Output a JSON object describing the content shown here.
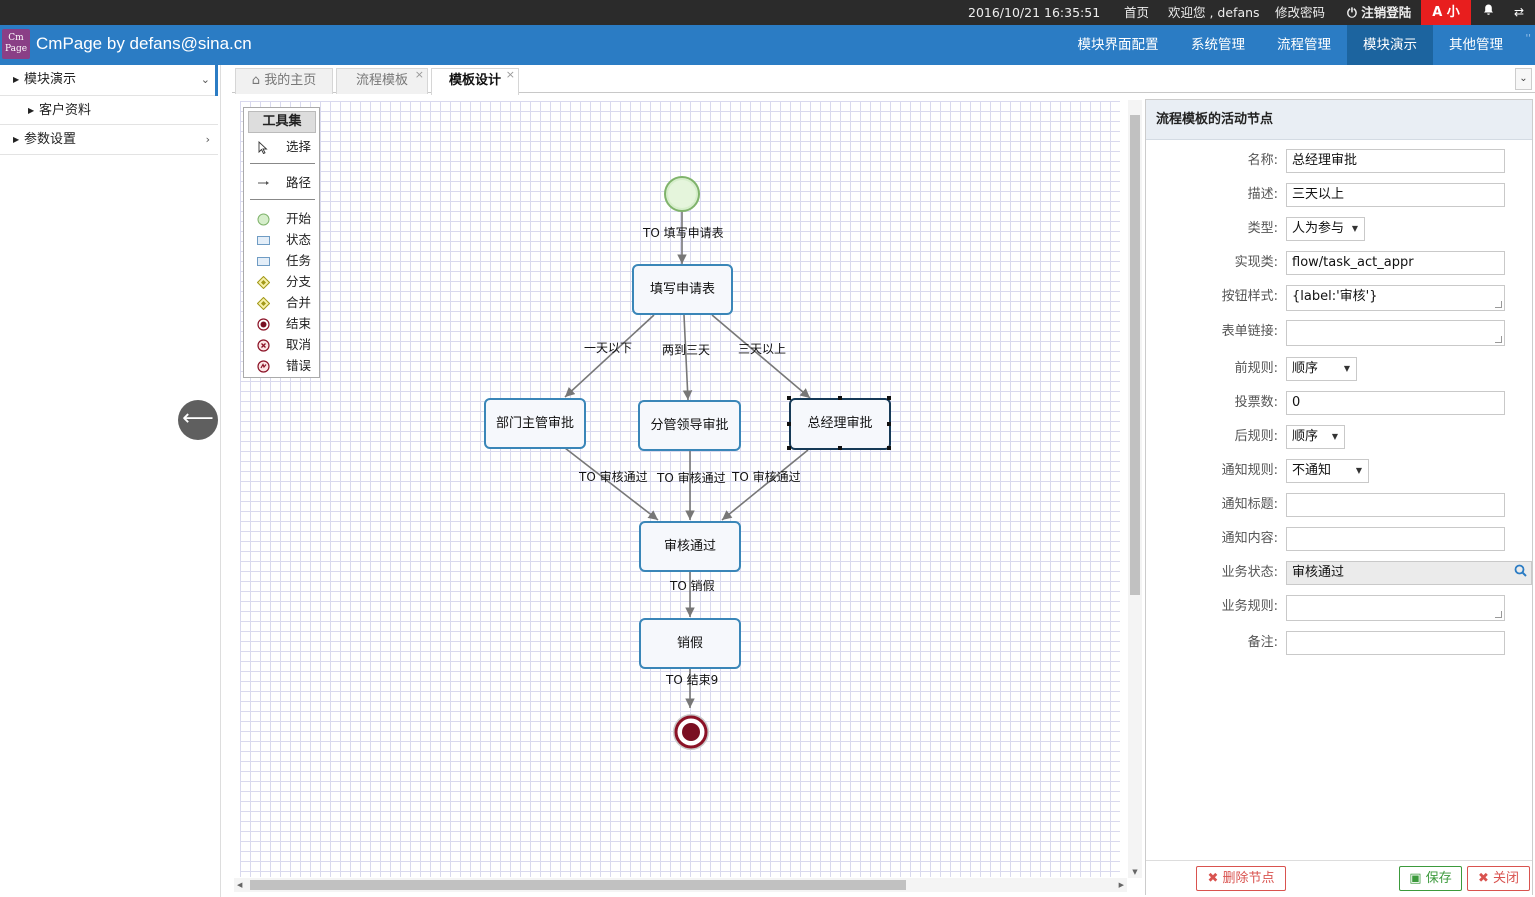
{
  "topbar": {
    "datetime": "2016/10/21 16:35:51",
    "home": "首页",
    "welcome": "欢迎您 , defans",
    "change_password": "修改密码",
    "logout": "注销登陆",
    "font_toggle": "A 小",
    "bell_icon": "bell-icon",
    "swap_icon": "swap-icon"
  },
  "header": {
    "logo_text_1": "Cm",
    "logo_text_2": "Page",
    "brand": "CmPage by defans@sina.cn",
    "nav": [
      "模块界面配置",
      "系统管理",
      "流程管理",
      "模块演示",
      "其他管理"
    ],
    "active_nav": "模块演示",
    "accent": "#2b7cc4"
  },
  "sidebar": {
    "items": [
      {
        "label": "模块演示",
        "expanded": true
      },
      {
        "label": "客户资料",
        "child": true
      },
      {
        "label": "参数设置",
        "expanded": false
      }
    ]
  },
  "tabs": [
    {
      "label": "我的主页",
      "icon": "home-icon",
      "closable": false
    },
    {
      "label": "流程模板",
      "closable": true
    },
    {
      "label": "模板设计",
      "closable": true,
      "active": true
    }
  ],
  "toolbox": {
    "title": "工具集",
    "tools": [
      "选择",
      "路径",
      "开始",
      "状态",
      "任务",
      "分支",
      "合并",
      "结束",
      "取消",
      "错误"
    ]
  },
  "diagram": {
    "nodes": {
      "fill_form": "填写申请表",
      "dept_manager": "部门主管审批",
      "deputy_leader": "分管领导审批",
      "general_manager": "总经理审批",
      "approved": "审核通过",
      "cancel_leave": "销假"
    },
    "edges": {
      "to_fill_form": "TO 填写申请表",
      "less_than_one_day": "一天以下",
      "two_to_three_days": "两到三天",
      "more_than_three_days": "三天以上",
      "approve_1": "TO 审核通过",
      "approve_2": "TO 审核通过",
      "approve_3": "TO 审核通过",
      "to_cancel_leave": "TO 销假",
      "to_end": "TO 结束9"
    }
  },
  "panel": {
    "title": "流程模板的活动节点",
    "fields": {
      "name": {
        "label": "名称:",
        "value": "总经理审批"
      },
      "description": {
        "label": "描述:",
        "value": "三天以上"
      },
      "type": {
        "label": "类型:",
        "value": "人为参与"
      },
      "impl_class": {
        "label": "实现类:",
        "value": "flow/task_act_appr"
      },
      "button_style": {
        "label": "按钮样式:",
        "value": "{label:'审核'}"
      },
      "form_link": {
        "label": "表单链接:",
        "value": ""
      },
      "pre_rule": {
        "label": "前规则:",
        "value": "顺序"
      },
      "votes": {
        "label": "投票数:",
        "value": "0"
      },
      "post_rule": {
        "label": "后规则:",
        "value": "顺序"
      },
      "notify_rule": {
        "label": "通知规则:",
        "value": "不通知"
      },
      "notify_title": {
        "label": "通知标题:",
        "value": ""
      },
      "notify_content": {
        "label": "通知内容:",
        "value": ""
      },
      "biz_status": {
        "label": "业务状态:",
        "value": "审核通过"
      },
      "biz_rule": {
        "label": "业务规则:",
        "value": ""
      },
      "remark": {
        "label": "备注:",
        "value": ""
      }
    },
    "buttons": {
      "delete": "删除节点",
      "save": "保存",
      "close": "关闭"
    }
  }
}
